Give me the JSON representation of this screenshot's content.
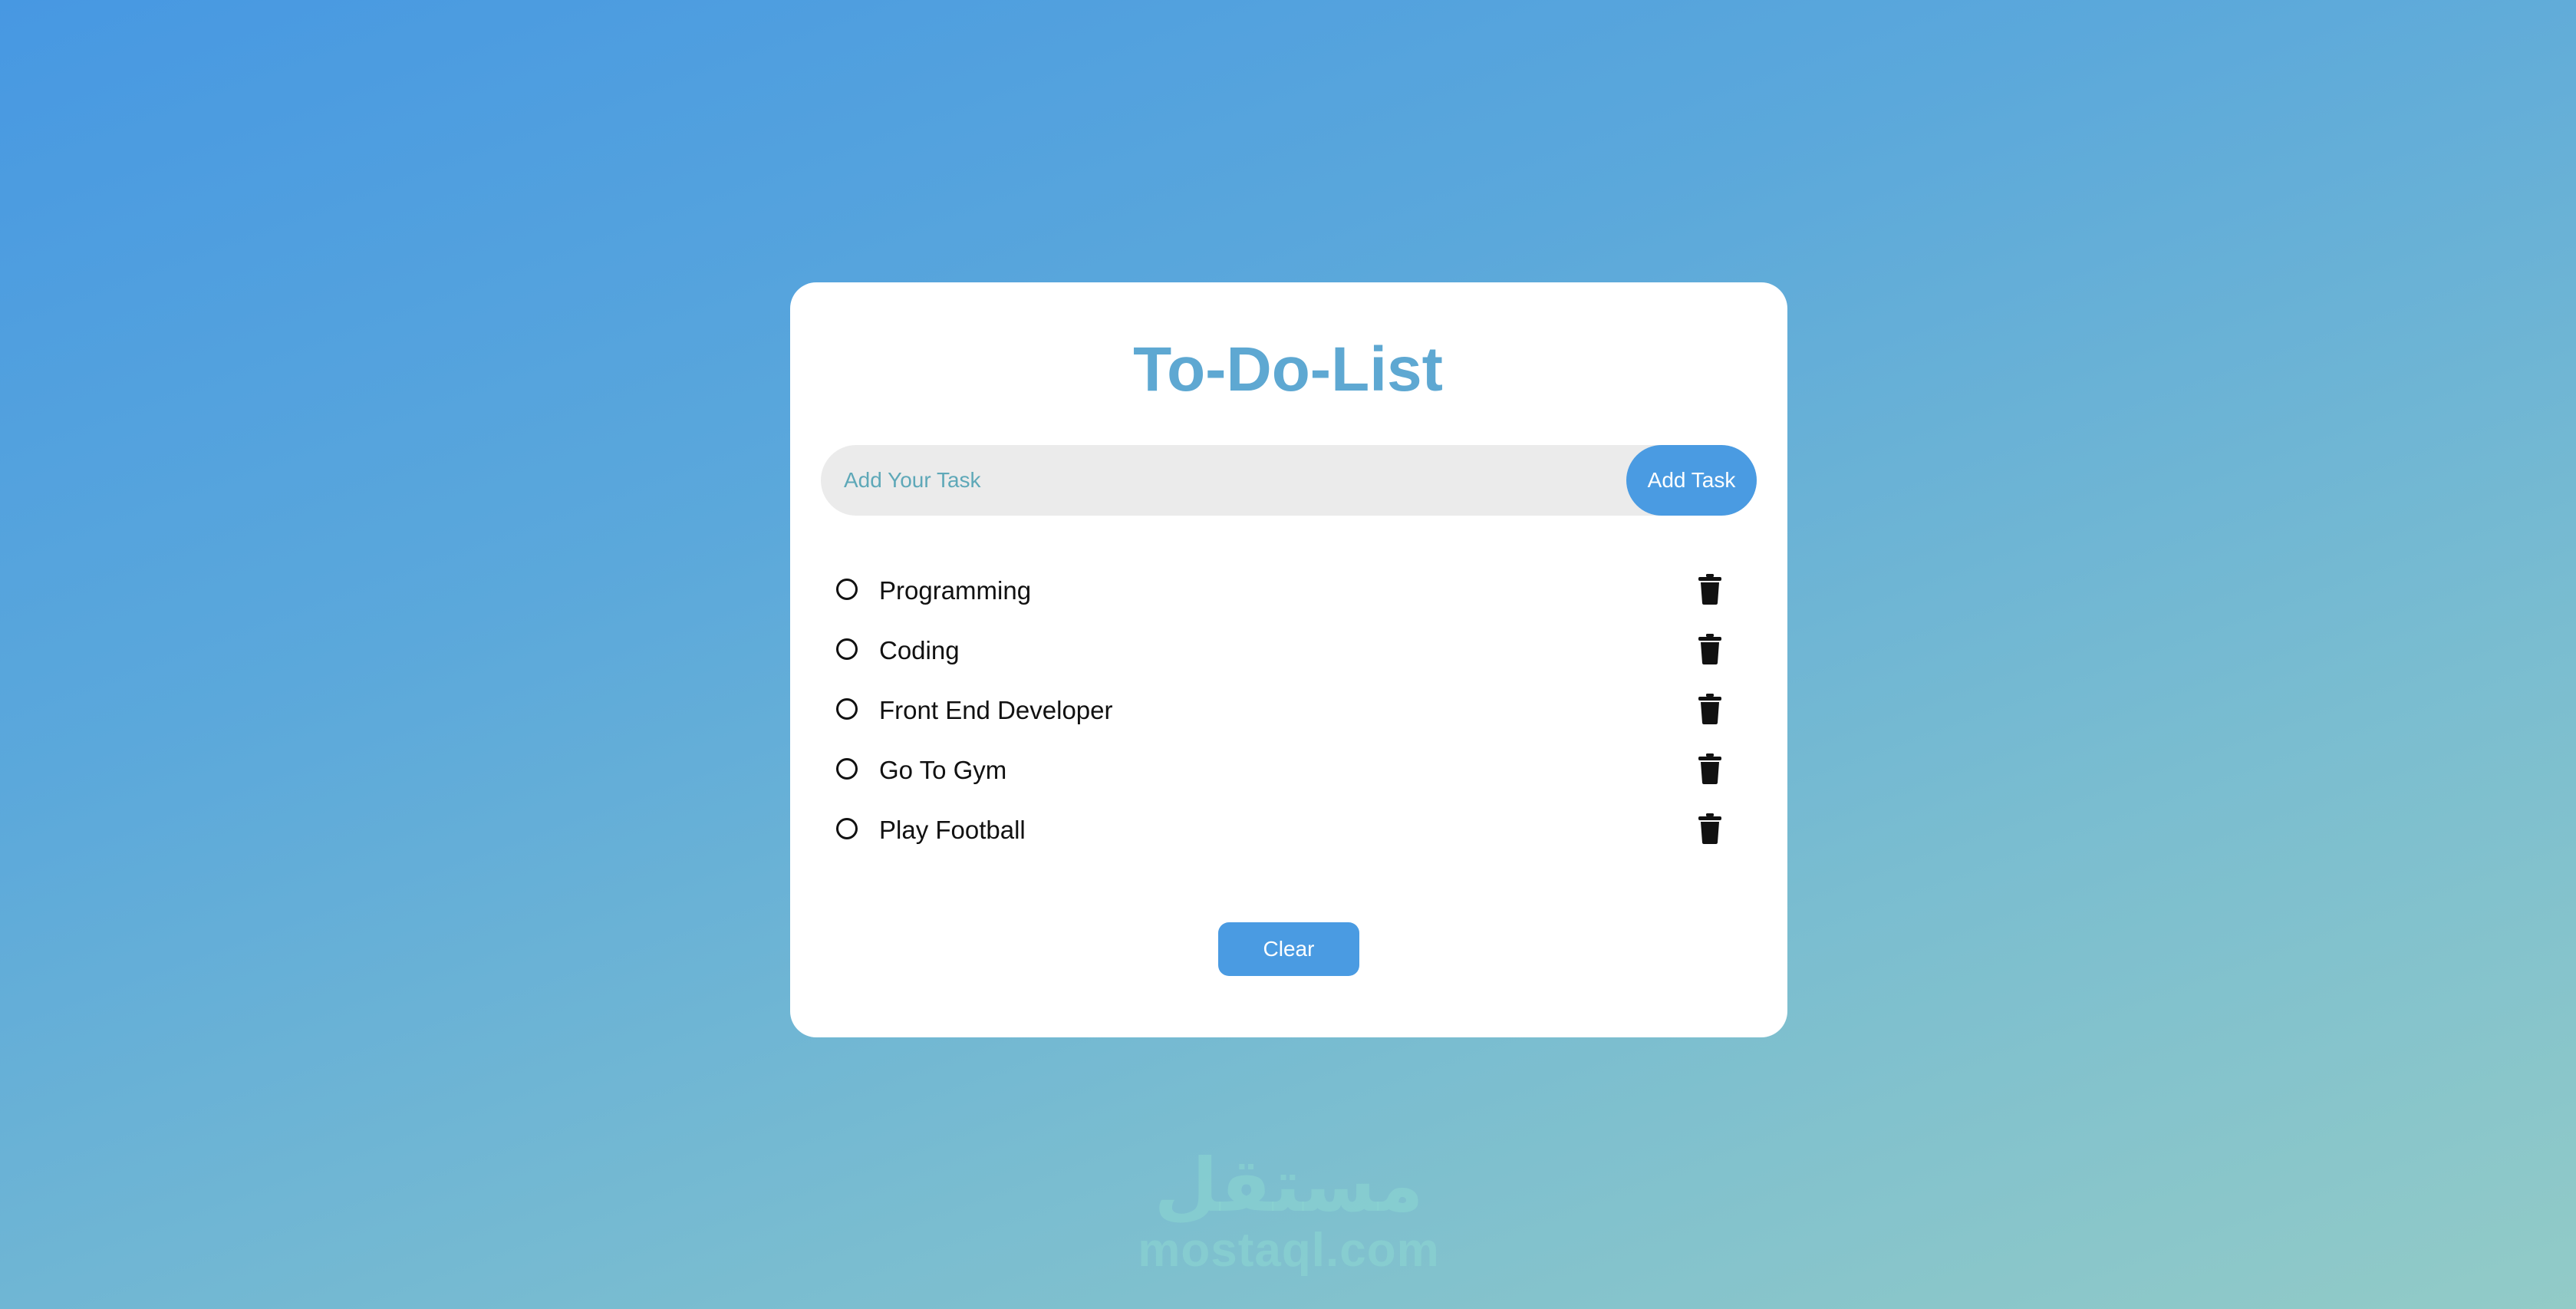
{
  "app": {
    "title": "To-Do-List"
  },
  "input": {
    "placeholder": "Add Your Task",
    "value": ""
  },
  "buttons": {
    "add_label": "Add Task",
    "clear_label": "Clear"
  },
  "tasks": [
    {
      "label": "Programming",
      "done": false,
      "icon": "trash-icon"
    },
    {
      "label": "Coding",
      "done": false,
      "icon": "trash-icon"
    },
    {
      "label": "Front End Developer",
      "done": false,
      "icon": "trash-icon"
    },
    {
      "label": "Go To Gym",
      "done": false,
      "icon": "trash-icon"
    },
    {
      "label": "Play Football",
      "done": false,
      "icon": "trash-icon"
    }
  ],
  "watermark": {
    "arabic": "مستقل",
    "latin": "mostaql.com"
  },
  "colors": {
    "accent": "#4a9be2",
    "title": "#5ea8d2",
    "input_background": "#ebebeb",
    "background_start": "#4798e2",
    "background_end": "#92cbc7"
  }
}
